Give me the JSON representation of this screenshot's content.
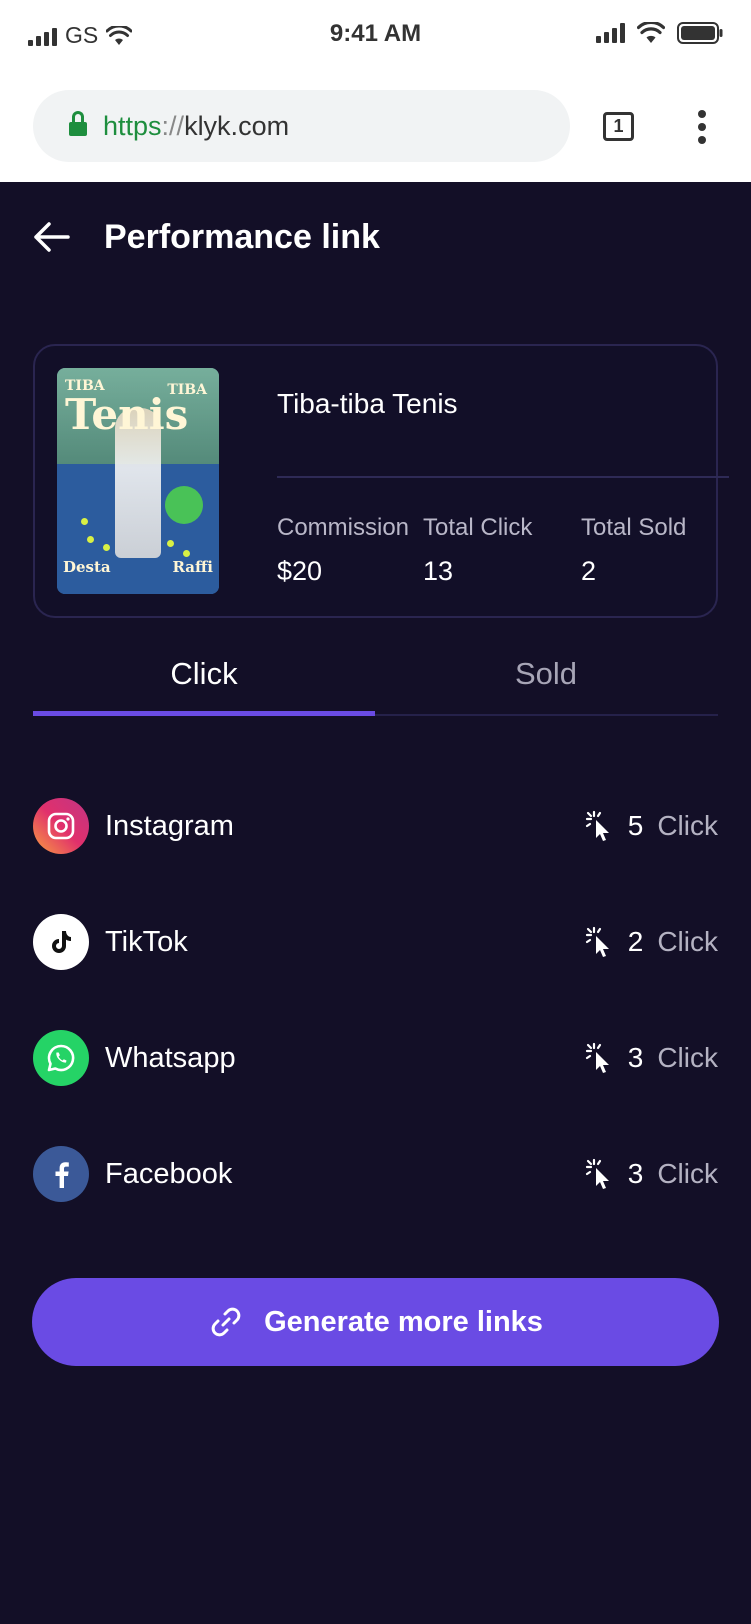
{
  "status_bar": {
    "carrier": "GS",
    "time": "9:41 AM"
  },
  "browser": {
    "url_scheme": "https",
    "url_separator": "://",
    "url_host": "klyk.com",
    "tab_count": "1"
  },
  "header": {
    "title": "Performance link"
  },
  "product": {
    "name": "Tiba-tiba Tenis",
    "cover_title": "Tenis",
    "cover_tiba_left": "TIBA",
    "cover_tiba_right": "TIBA",
    "cover_name_left": "Desta",
    "cover_name_right": "Raffi",
    "stats": [
      {
        "label": "Commission",
        "value": "$20"
      },
      {
        "label": "Total Click",
        "value": "13"
      },
      {
        "label": "Total Sold",
        "value": "2"
      }
    ]
  },
  "tabs": [
    {
      "label": "Click",
      "active": true
    },
    {
      "label": "Sold",
      "active": false
    }
  ],
  "channels": [
    {
      "name": "Instagram",
      "count": "5",
      "unit": "Click",
      "icon": "instagram-icon"
    },
    {
      "name": "TikTok",
      "count": "2",
      "unit": "Click",
      "icon": "tiktok-icon"
    },
    {
      "name": "Whatsapp",
      "count": "3",
      "unit": "Click",
      "icon": "whatsapp-icon"
    },
    {
      "name": "Facebook",
      "count": "3",
      "unit": "Click",
      "icon": "facebook-icon"
    }
  ],
  "cta": {
    "label": "Generate more links",
    "icon": "link-icon"
  },
  "colors": {
    "background": "#130f27",
    "accent": "#6a4be4",
    "instagram": "#e1306c",
    "whatsapp": "#25d366",
    "facebook": "#3b5998"
  }
}
